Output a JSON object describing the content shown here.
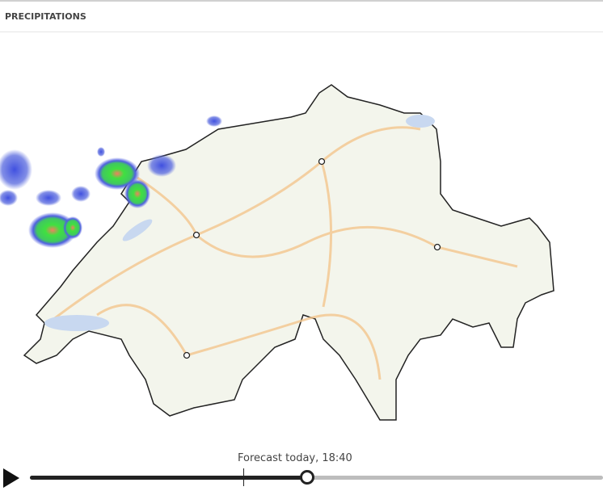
{
  "header": {
    "title": "PRECIPITATIONS"
  },
  "timeline": {
    "label": "Forecast today, 18:40",
    "progress": 0.484,
    "now_marker": 0.372
  },
  "map": {
    "cities": [
      "city-1",
      "city-2",
      "city-3",
      "city-4"
    ]
  },
  "colors": {
    "border": "#222222",
    "land": "#f4f6ee",
    "roads": "#f3c68e",
    "rain_light": "#5060e0",
    "rain_mid": "#40e040",
    "rain_heavy": "#f08060"
  }
}
